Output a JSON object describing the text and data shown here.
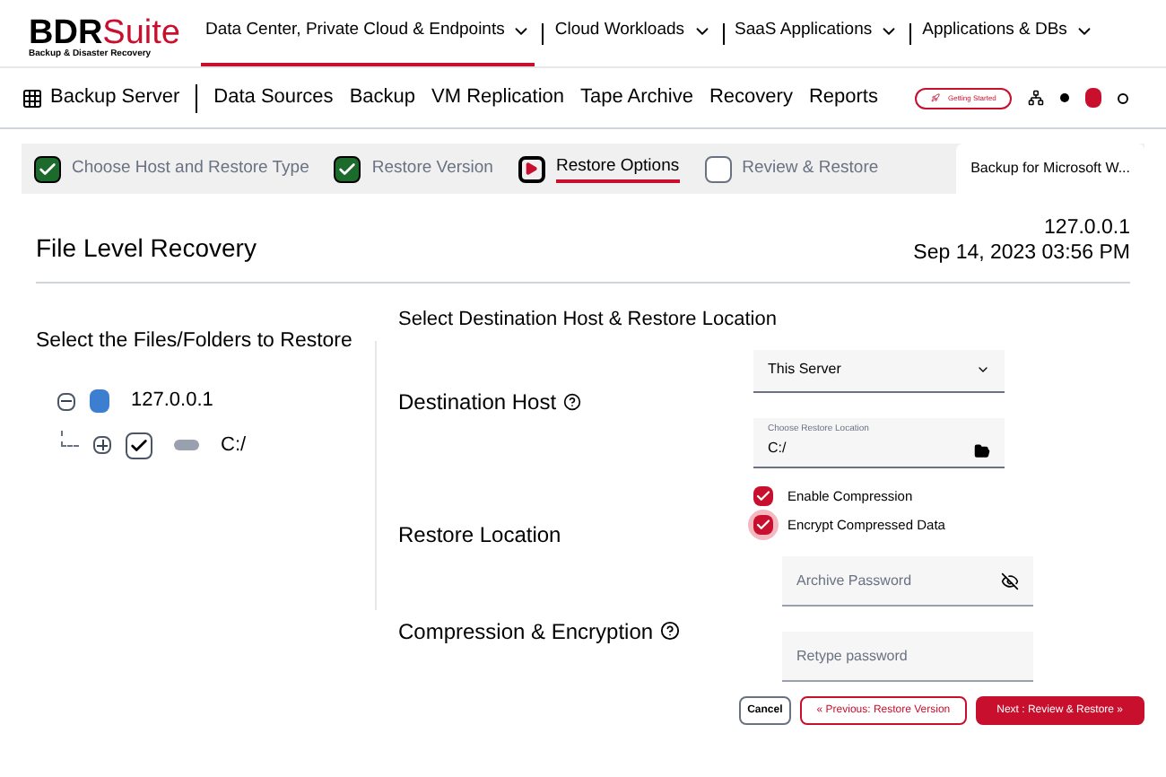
{
  "brand": {
    "name_dark": "BDR",
    "name_red": "Suite",
    "tagline": "Backup & Disaster Recovery"
  },
  "top_menu": [
    {
      "label": "Data Center, Private Cloud & Endpoints",
      "selected": true
    },
    {
      "label": "Cloud Workloads",
      "selected": false
    },
    {
      "label": "SaaS Applications",
      "selected": false
    },
    {
      "label": "Applications & DBs",
      "selected": false
    }
  ],
  "sub_nav": {
    "home": "Backup Server",
    "items": [
      {
        "label": "Data Sources",
        "selected": false
      },
      {
        "label": "Backup",
        "selected": false
      },
      {
        "label": "VM Replication",
        "selected": false
      },
      {
        "label": "Tape Archive",
        "selected": false
      },
      {
        "label": "Recovery",
        "selected": false
      },
      {
        "label": "Reports",
        "selected": false
      }
    ],
    "getting_started": "Getting Started"
  },
  "steps": [
    {
      "label": "Choose Host and Restore Type",
      "kind": "done",
      "selected": false
    },
    {
      "label": "Restore Version",
      "kind": "done",
      "selected": false
    },
    {
      "label": "Restore Options",
      "kind": "current",
      "selected": true
    },
    {
      "label": "Review & Restore",
      "kind": "pending",
      "selected": false
    }
  ],
  "context_tab": "Backup for Microsoft W...",
  "page": {
    "title": "File Level Recovery",
    "host": "127.0.0.1",
    "timestamp": "Sep 14, 2023 03:56 PM"
  },
  "tree": {
    "heading": "Select the Files/Folders to Restore",
    "root": {
      "label": "127.0.0.1",
      "expanded": true,
      "children": [
        {
          "label": "C:/",
          "expanded": false,
          "checked": true
        }
      ]
    }
  },
  "destination": {
    "heading": "Select Destination Host & Restore Location",
    "labels": [
      "Destination Host",
      "Restore Location",
      "Compression & Encryption"
    ],
    "host_select": {
      "value": "This Server"
    },
    "location": {
      "label": "Choose Restore Location",
      "value": "C:/"
    },
    "options": [
      {
        "label": "Enable Compression",
        "checked": true,
        "focused": false
      },
      {
        "label": "Encrypt Compressed Data",
        "checked": true,
        "focused": true
      }
    ],
    "password": {
      "placeholder": "Archive Password"
    },
    "retype": {
      "placeholder": "Retype password"
    }
  },
  "buttons": {
    "cancel": "Cancel",
    "previous": "« Previous: Restore Version",
    "next": "Next : Review & Restore »"
  }
}
